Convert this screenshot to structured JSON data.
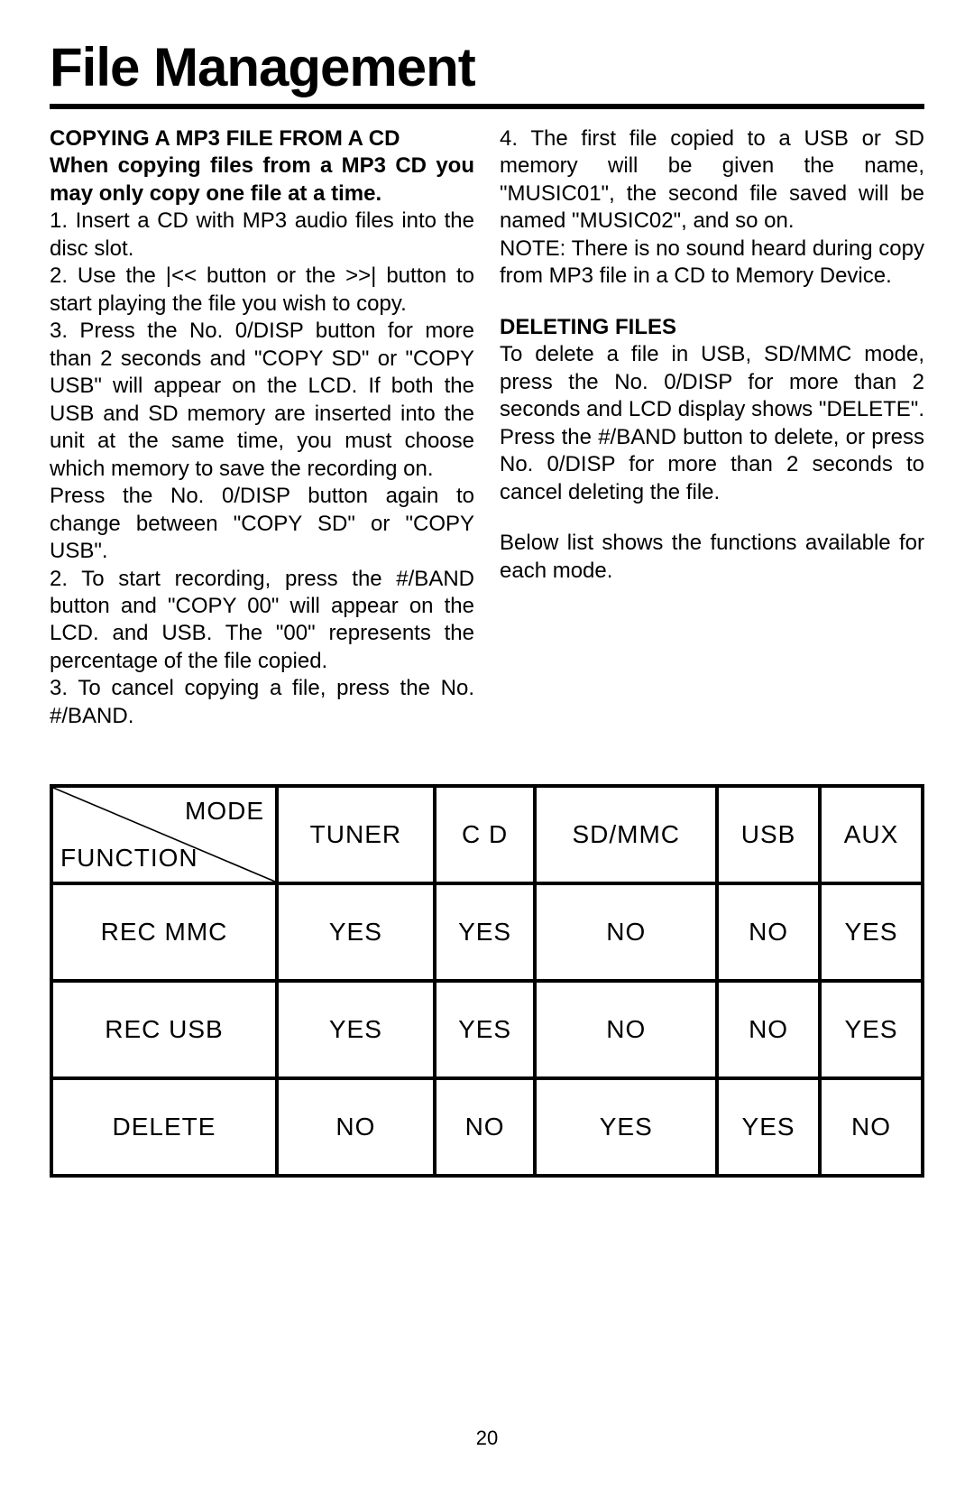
{
  "title": "File Management",
  "page_number": "20",
  "left_column": {
    "heading": "COPYING A MP3 FILE FROM A CD",
    "subheading": "When copying files from a MP3 CD you may only copy one file at a time.",
    "p1": "1. Insert a CD with MP3 audio files into the disc slot.",
    "p2": "2. Use the |<< button or the >>| button to start playing the file you wish to copy.",
    "p3": "3. Press the No. 0/DISP button for more than 2 seconds and \"COPY SD\" or \"COPY USB\" will appear on the LCD. If both the USB and SD memory are inserted into the unit at the same time, you must choose which memory to save the recording on.",
    "p4": "Press the No. 0/DISP button again to change between \"COPY SD\" or \"COPY USB\".",
    "p5": "2. To start recording, press the #/BAND button and \"COPY  00\" will appear on the LCD. and USB. The \"00\" represents the percentage of the file copied.",
    "p6": "3. To cancel copying a file, press the No. #/BAND."
  },
  "right_column": {
    "p1": "4. The first file copied to a USB or SD memory will be given the name, \"MUSIC01\", the second file saved will be named \"MUSIC02\", and so on.",
    "p2": "NOTE: There is no sound heard during copy from MP3 file in a CD to Memory Device.",
    "heading2": "DELETING FILES",
    "p3": "To delete a file in USB, SD/MMC mode, press the No. 0/DISP for more than 2 seconds and LCD display shows \"DELETE\". Press the #/BAND button to delete, or press No. 0/DISP for more than 2 seconds to cancel deleting the file.",
    "p4": "Below list shows the functions available for each mode."
  },
  "table": {
    "corner_mode": "MODE",
    "corner_function": "FUNCTION",
    "headers": [
      "TUNER",
      "C D",
      "SD/MMC",
      "USB",
      "AUX"
    ],
    "rows": [
      {
        "label": "REC MMC",
        "cells": [
          "YES",
          "YES",
          "NO",
          "NO",
          "YES"
        ]
      },
      {
        "label": "REC USB",
        "cells": [
          "YES",
          "YES",
          "NO",
          "NO",
          "YES"
        ]
      },
      {
        "label": "DELETE",
        "cells": [
          "NO",
          "NO",
          "YES",
          "YES",
          "NO"
        ]
      }
    ]
  }
}
